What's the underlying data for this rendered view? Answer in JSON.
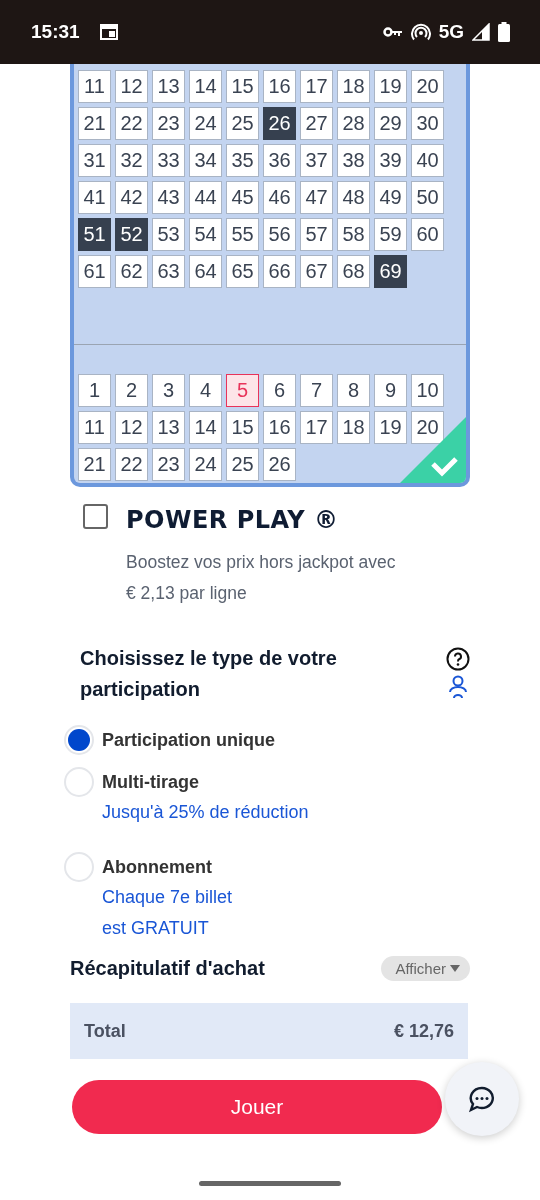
{
  "status_bar": {
    "time": "15:31",
    "network": "5G"
  },
  "number_grid": {
    "complete": true,
    "main": [
      {
        "n": "11",
        "selected": false
      },
      {
        "n": "12",
        "selected": false
      },
      {
        "n": "13",
        "selected": false
      },
      {
        "n": "14",
        "selected": false
      },
      {
        "n": "15",
        "selected": false
      },
      {
        "n": "16",
        "selected": false
      },
      {
        "n": "17",
        "selected": false
      },
      {
        "n": "18",
        "selected": false
      },
      {
        "n": "19",
        "selected": false
      },
      {
        "n": "20",
        "selected": false
      },
      {
        "n": "21",
        "selected": false
      },
      {
        "n": "22",
        "selected": false
      },
      {
        "n": "23",
        "selected": false
      },
      {
        "n": "24",
        "selected": false
      },
      {
        "n": "25",
        "selected": false
      },
      {
        "n": "26",
        "selected": true
      },
      {
        "n": "27",
        "selected": false
      },
      {
        "n": "28",
        "selected": false
      },
      {
        "n": "29",
        "selected": false
      },
      {
        "n": "30",
        "selected": false
      },
      {
        "n": "31",
        "selected": false
      },
      {
        "n": "32",
        "selected": false
      },
      {
        "n": "33",
        "selected": false
      },
      {
        "n": "34",
        "selected": false
      },
      {
        "n": "35",
        "selected": false
      },
      {
        "n": "36",
        "selected": false
      },
      {
        "n": "37",
        "selected": false
      },
      {
        "n": "38",
        "selected": false
      },
      {
        "n": "39",
        "selected": false
      },
      {
        "n": "40",
        "selected": false
      },
      {
        "n": "41",
        "selected": false
      },
      {
        "n": "42",
        "selected": false
      },
      {
        "n": "43",
        "selected": false
      },
      {
        "n": "44",
        "selected": false
      },
      {
        "n": "45",
        "selected": false
      },
      {
        "n": "46",
        "selected": false
      },
      {
        "n": "47",
        "selected": false
      },
      {
        "n": "48",
        "selected": false
      },
      {
        "n": "49",
        "selected": false
      },
      {
        "n": "50",
        "selected": false
      },
      {
        "n": "51",
        "selected": true
      },
      {
        "n": "52",
        "selected": true
      },
      {
        "n": "53",
        "selected": false
      },
      {
        "n": "54",
        "selected": false
      },
      {
        "n": "55",
        "selected": false
      },
      {
        "n": "56",
        "selected": false
      },
      {
        "n": "57",
        "selected": false
      },
      {
        "n": "58",
        "selected": false
      },
      {
        "n": "59",
        "selected": false
      },
      {
        "n": "60",
        "selected": false
      },
      {
        "n": "61",
        "selected": false
      },
      {
        "n": "62",
        "selected": false
      },
      {
        "n": "63",
        "selected": false
      },
      {
        "n": "64",
        "selected": false
      },
      {
        "n": "65",
        "selected": false
      },
      {
        "n": "66",
        "selected": false
      },
      {
        "n": "67",
        "selected": false
      },
      {
        "n": "68",
        "selected": false
      },
      {
        "n": "69",
        "selected": true
      }
    ],
    "powerball": [
      {
        "n": "1",
        "selected": false
      },
      {
        "n": "2",
        "selected": false
      },
      {
        "n": "3",
        "selected": false
      },
      {
        "n": "4",
        "selected": false
      },
      {
        "n": "5",
        "selected": true
      },
      {
        "n": "6",
        "selected": false
      },
      {
        "n": "7",
        "selected": false
      },
      {
        "n": "8",
        "selected": false
      },
      {
        "n": "9",
        "selected": false
      },
      {
        "n": "10",
        "selected": false
      },
      {
        "n": "11",
        "selected": false
      },
      {
        "n": "12",
        "selected": false
      },
      {
        "n": "13",
        "selected": false
      },
      {
        "n": "14",
        "selected": false
      },
      {
        "n": "15",
        "selected": false
      },
      {
        "n": "16",
        "selected": false
      },
      {
        "n": "17",
        "selected": false
      },
      {
        "n": "18",
        "selected": false
      },
      {
        "n": "19",
        "selected": false
      },
      {
        "n": "20",
        "selected": false
      },
      {
        "n": "21",
        "selected": false
      },
      {
        "n": "22",
        "selected": false
      },
      {
        "n": "23",
        "selected": false
      },
      {
        "n": "24",
        "selected": false
      },
      {
        "n": "25",
        "selected": false
      },
      {
        "n": "26",
        "selected": false
      }
    ]
  },
  "power_play": {
    "checked": false,
    "title": "POWER PLAY ®",
    "description": "Boostez vos prix hors jackpot avec € 2,13 par ligne"
  },
  "participation": {
    "title": "Choisissez le type de votre participation",
    "options": [
      {
        "label": "Participation unique",
        "selected": true
      },
      {
        "label": "Multi-tirage",
        "note": "Jusqu'à 25% de réduction",
        "selected": false
      },
      {
        "label": "Abonnement",
        "note": "Chaque 7e billet\nest GRATUIT",
        "selected": false
      }
    ]
  },
  "summary": {
    "title": "Récapitulatif d'achat",
    "toggle": "Afficher",
    "total_label": "Total",
    "total_value": "€ 12,76"
  },
  "play_button": "Jouer"
}
